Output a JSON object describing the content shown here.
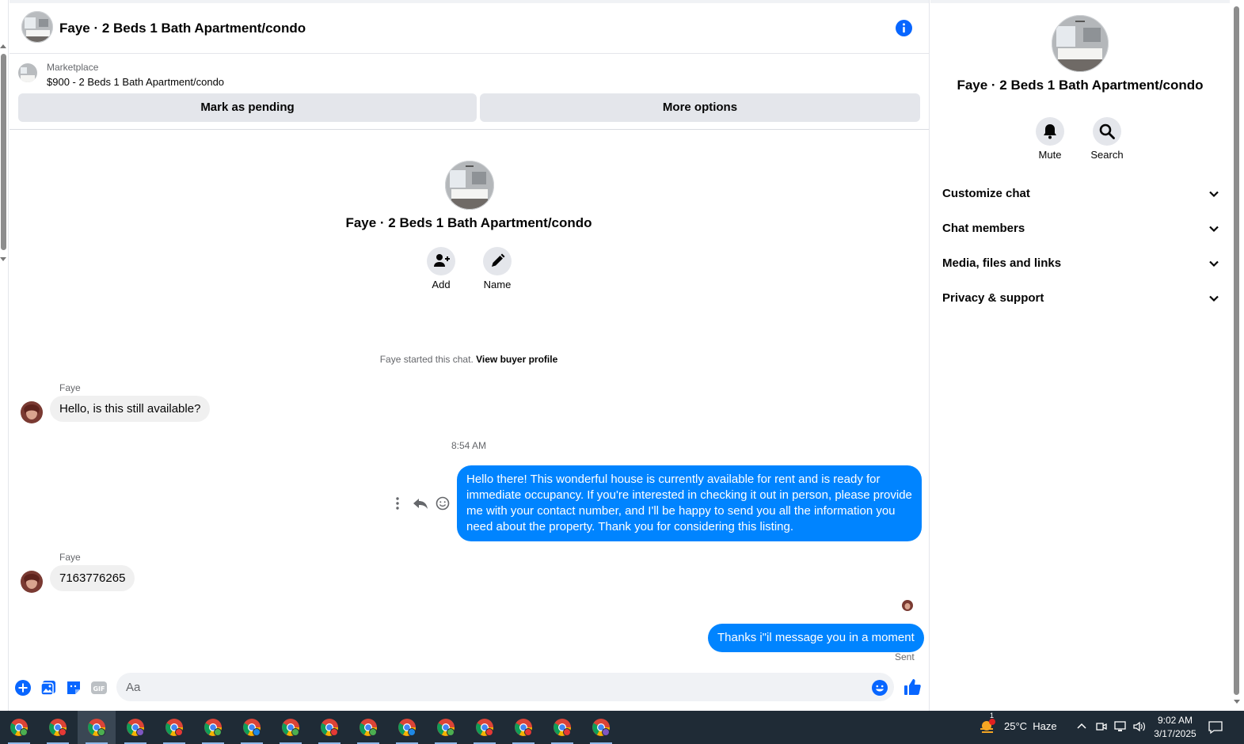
{
  "header": {
    "title": "Faye · 2 Beds 1 Bath Apartment/condo"
  },
  "listing": {
    "category": "Marketplace",
    "price_title": "$900 - 2 Beds 1 Bath Apartment/condo",
    "mark_pending": "Mark as pending",
    "more_options": "More options"
  },
  "intro": {
    "title": "Faye · 2 Beds 1 Bath Apartment/condo",
    "add_label": "Add",
    "name_label": "Name",
    "started_text": "Faye started this chat.",
    "view_profile": "View buyer profile"
  },
  "messages": {
    "m1_sender": "Faye",
    "m1_text": "Hello, is this still available?",
    "timestamp": "8:54 AM",
    "m2_text": "Hello there! This wonderful house is currently available for rent and is ready for immediate occupancy. If you're interested in checking it out in person, please provide me with your contact number, and I'll be happy to send you all the information you need about the property. Thank you for considering this listing.",
    "m3_sender": "Faye",
    "m3_text": "7163776265",
    "m4_text": "Thanks i\"il message you in a moment",
    "status": "Sent"
  },
  "composer": {
    "placeholder": "Aa"
  },
  "panel": {
    "title": "Faye · 2 Beds 1 Bath Apartment/condo",
    "mute_label": "Mute",
    "search_label": "Search",
    "sections": [
      "Customize chat",
      "Chat members",
      "Media, files and links",
      "Privacy & support"
    ]
  },
  "taskbar": {
    "weather": "25°C  Haze",
    "weather_badge": "1",
    "time": "9:02 AM",
    "date": "3/17/2025"
  },
  "colors": {
    "accent": "#0084ff",
    "bubble_in": "#f0f0f0",
    "button_bg": "#e4e6eb",
    "taskbar": "#1f2b36"
  }
}
